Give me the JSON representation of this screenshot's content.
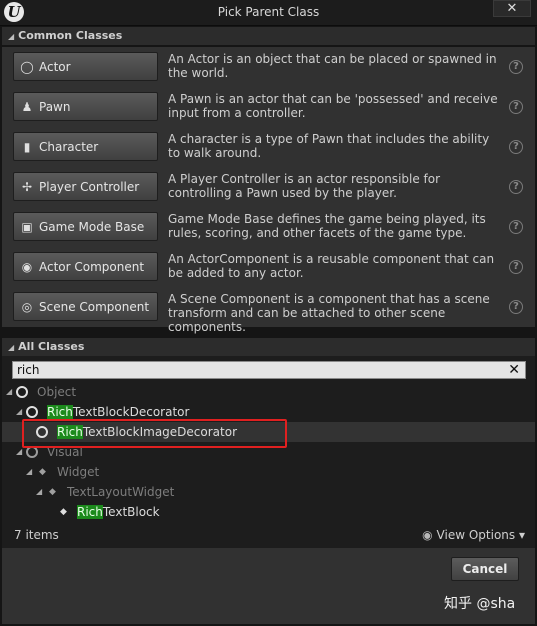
{
  "window": {
    "title": "Pick Parent Class",
    "close_glyph": "✕"
  },
  "common_classes": {
    "header": "Common Classes",
    "items": [
      {
        "label": "Actor",
        "icon": "sphere-icon",
        "desc": "An Actor is an object that can be placed or spawned in the world."
      },
      {
        "label": "Pawn",
        "icon": "pawn-icon",
        "desc": "A Pawn is an actor that can be 'possessed' and receive input from a controller."
      },
      {
        "label": "Character",
        "icon": "character-icon",
        "desc": "A character is a type of Pawn that includes the ability to walk around."
      },
      {
        "label": "Player Controller",
        "icon": "controller-icon",
        "desc": "A Player Controller is an actor responsible for controlling a Pawn used by the player."
      },
      {
        "label": "Game Mode Base",
        "icon": "game-mode-icon",
        "desc": "Game Mode Base defines the game being played, its rules, scoring, and other facets of the game type."
      },
      {
        "label": "Actor Component",
        "icon": "component-icon",
        "desc": "An ActorComponent is a reusable component that can be added to any actor."
      },
      {
        "label": "Scene Component",
        "icon": "scene-component-icon",
        "desc": "A Scene Component is a component that has a scene transform and can be attached to other scene components."
      }
    ]
  },
  "all_classes": {
    "header": "All Classes",
    "search_value": "rich",
    "tree": [
      {
        "match": "",
        "rest": "Object"
      },
      {
        "match": "Rich",
        "rest": "TextBlockDecorator"
      },
      {
        "match": "Rich",
        "rest": "TextBlockImageDecorator"
      },
      {
        "match": "",
        "rest": "Visual"
      },
      {
        "match": "",
        "rest": "Widget"
      },
      {
        "match": "",
        "rest": "TextLayoutWidget"
      },
      {
        "match": "Rich",
        "rest": "TextBlock"
      }
    ],
    "items_count": "7 items",
    "view_options": "View Options"
  },
  "footer": {
    "cancel_label": "Cancel",
    "watermark": "知乎 @sha"
  },
  "colors": {
    "highlight": "#1c8a1c",
    "selection_outline": "#e02020"
  }
}
